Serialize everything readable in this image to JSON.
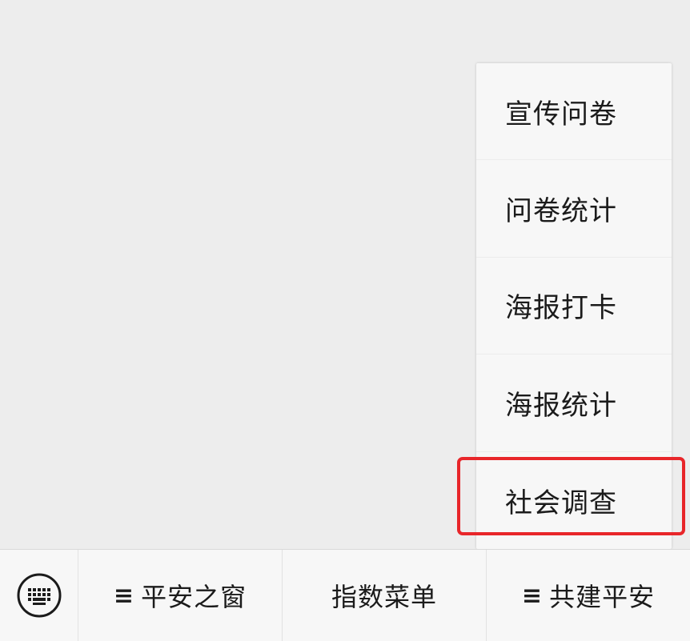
{
  "popup_menu": {
    "items": [
      {
        "label": "宣传问卷"
      },
      {
        "label": "问卷统计"
      },
      {
        "label": "海报打卡"
      },
      {
        "label": "海报统计"
      },
      {
        "label": "社会调查"
      }
    ],
    "highlighted_item": "社会调查",
    "highlight_color": "#e8262a"
  },
  "bottom_bar": {
    "keyboard_icon": "keyboard-icon",
    "menu_glyph": "≡",
    "tabs": [
      {
        "label": "平安之窗",
        "has_submenu": true
      },
      {
        "label": "指数菜单",
        "has_submenu": false
      },
      {
        "label": "共建平安",
        "has_submenu": true
      }
    ]
  }
}
